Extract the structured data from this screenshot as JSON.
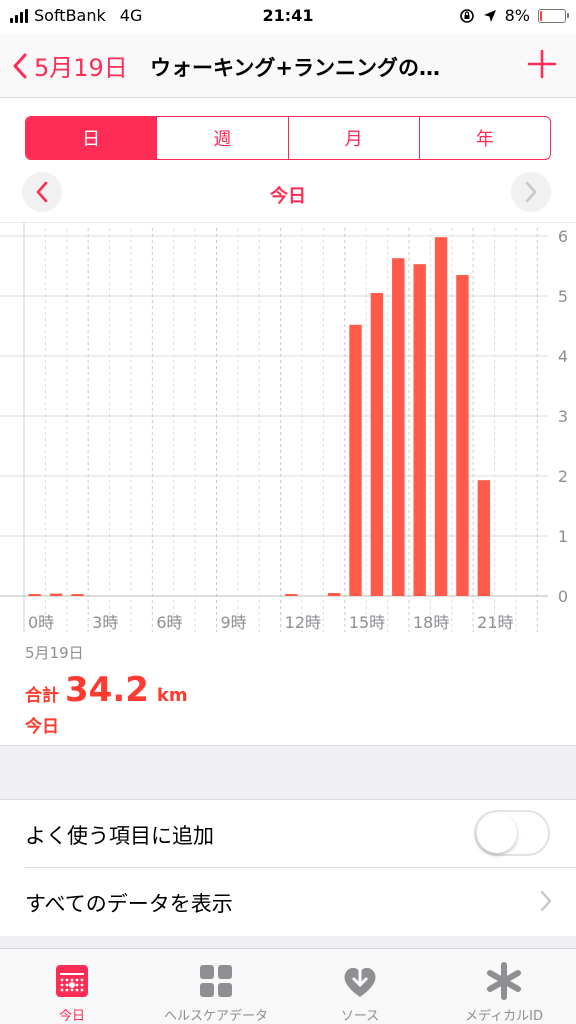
{
  "status": {
    "carrier": "SoftBank",
    "network": "4G",
    "time": "21:41",
    "battery": "8%",
    "battery_level": 0.08
  },
  "nav": {
    "back_label": "5月19日",
    "title": "ウォーキング+ランニングの…",
    "add_icon": "plus-icon"
  },
  "segments": [
    {
      "label": "日",
      "active": true
    },
    {
      "label": "週",
      "active": false
    },
    {
      "label": "月",
      "active": false
    },
    {
      "label": "年",
      "active": false
    }
  ],
  "date_nav": {
    "label": "今日"
  },
  "chart_data": {
    "type": "bar",
    "x_ticks": [
      "0時",
      "3時",
      "6時",
      "9時",
      "12時",
      "15時",
      "18時",
      "21時"
    ],
    "x_tick_hours": [
      0,
      3,
      6,
      9,
      12,
      15,
      18,
      21
    ],
    "y_ticks": [
      "0",
      "1",
      "2",
      "3",
      "4",
      "5",
      "6"
    ],
    "ylim": [
      0,
      6
    ],
    "xlim": [
      -0.5,
      24
    ],
    "hours": [
      0,
      1,
      2,
      3,
      4,
      5,
      6,
      7,
      8,
      9,
      10,
      11,
      12,
      13,
      14,
      15,
      16,
      17,
      18,
      19,
      20,
      21,
      22,
      23
    ],
    "values": [
      0.02,
      0.04,
      0.02,
      0,
      0,
      0,
      0,
      0,
      0,
      0,
      0,
      0,
      0.03,
      0,
      0.05,
      4.52,
      5.05,
      5.63,
      5.53,
      5.98,
      5.35,
      1.93,
      0,
      0
    ],
    "bar_color": "#ff5a4a",
    "grid": true
  },
  "summary": {
    "date": "5月19日",
    "total_label": "合計",
    "total_value": "34.2",
    "unit": "km",
    "sub_label": "今日"
  },
  "rows": {
    "favorite_label": "よく使う項目に追加",
    "favorite_on": false,
    "show_all_label": "すべてのデータを表示"
  },
  "tabs": [
    {
      "label": "今日",
      "icon": "calendar-icon",
      "active": true
    },
    {
      "label": "ヘルスケアデータ",
      "icon": "grid-icon",
      "active": false
    },
    {
      "label": "ソース",
      "icon": "heart-download-icon",
      "active": false
    },
    {
      "label": "メディカルID",
      "icon": "asterisk-icon",
      "active": false
    }
  ],
  "colors": {
    "accent": "#ff2d55",
    "value_red": "#ff3b30"
  }
}
